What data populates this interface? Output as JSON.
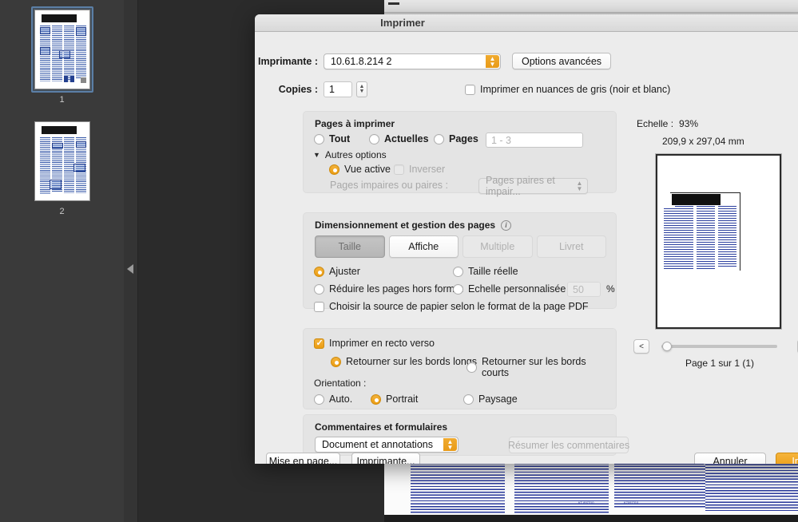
{
  "window": {
    "title": "Imprimer"
  },
  "printer": {
    "label": "Imprimante :",
    "value": "10.61.8.214 2",
    "advanced_button": "Options avancées"
  },
  "copies": {
    "label": "Copies :",
    "value": "1",
    "grayscale_label": "Imprimer en nuances de gris (noir et blanc)",
    "grayscale_checked": false
  },
  "pages_group": {
    "title": "Pages à imprimer",
    "all_label": "Tout",
    "current_label": "Actuelles",
    "pages_label": "Pages",
    "pages_placeholder": "1 - 3",
    "more_options_label": "Autres options",
    "active_view_label": "Vue active",
    "reverse_label": "Inverser",
    "odd_even_label": "Pages impaires ou paires :",
    "odd_even_value": "Pages paires et impair...",
    "selected": "vue_active"
  },
  "sizing_group": {
    "title": "Dimensionnement et gestion des pages",
    "info_icon": "info-icon",
    "tabs": [
      {
        "label": "Taille",
        "state": "active"
      },
      {
        "label": "Affiche",
        "state": "normal"
      },
      {
        "label": "Multiple",
        "state": "disabled"
      },
      {
        "label": "Livret",
        "state": "disabled"
      }
    ],
    "fit_label": "Ajuster",
    "actual_size_label": "Taille réelle",
    "shrink_label": "Réduire les pages hors format",
    "custom_scale_label": "Echelle personnalisée :",
    "custom_scale_value": "50",
    "percent_symbol": "%",
    "paper_source_label": "Choisir la source de papier selon le format de la page PDF",
    "paper_source_checked": false,
    "selected": "ajuster"
  },
  "duplex_group": {
    "duplex_label": "Imprimer en recto verso",
    "duplex_checked": true,
    "long_edge_label": "Retourner sur les bords longs",
    "short_edge_label": "Retourner sur les bords courts",
    "edge_selected": "long",
    "orientation_label": "Orientation :",
    "auto_label": "Auto.",
    "portrait_label": "Portrait",
    "landscape_label": "Paysage",
    "orientation_selected": "portrait"
  },
  "comments_group": {
    "title": "Commentaires et formulaires",
    "select_value": "Document et annotations",
    "summarize_button": "Résumer les commentaires"
  },
  "footer": {
    "page_setup_button": "Mise en page...",
    "printer_button": "Imprimante...",
    "cancel_button": "Annuler",
    "print_button": "Imprimer"
  },
  "preview": {
    "scale_label": "Echelle :",
    "scale_value": "93%",
    "dimensions": "209,9 x 297,04 mm",
    "prev_icon": "<",
    "next_icon": ">",
    "page_status": "Page 1 sur 1 (1)"
  },
  "thumbnails": {
    "items": [
      {
        "label": "1",
        "selected": true
      },
      {
        "label": "2",
        "selected": false
      }
    ],
    "collapse_icon": "left-triangle-icon"
  },
  "colors": {
    "accent": "#eb9c12",
    "dialog_bg": "#ececec",
    "group_bg": "#e4e4e4",
    "selection_blue": "#5b7fa6"
  }
}
